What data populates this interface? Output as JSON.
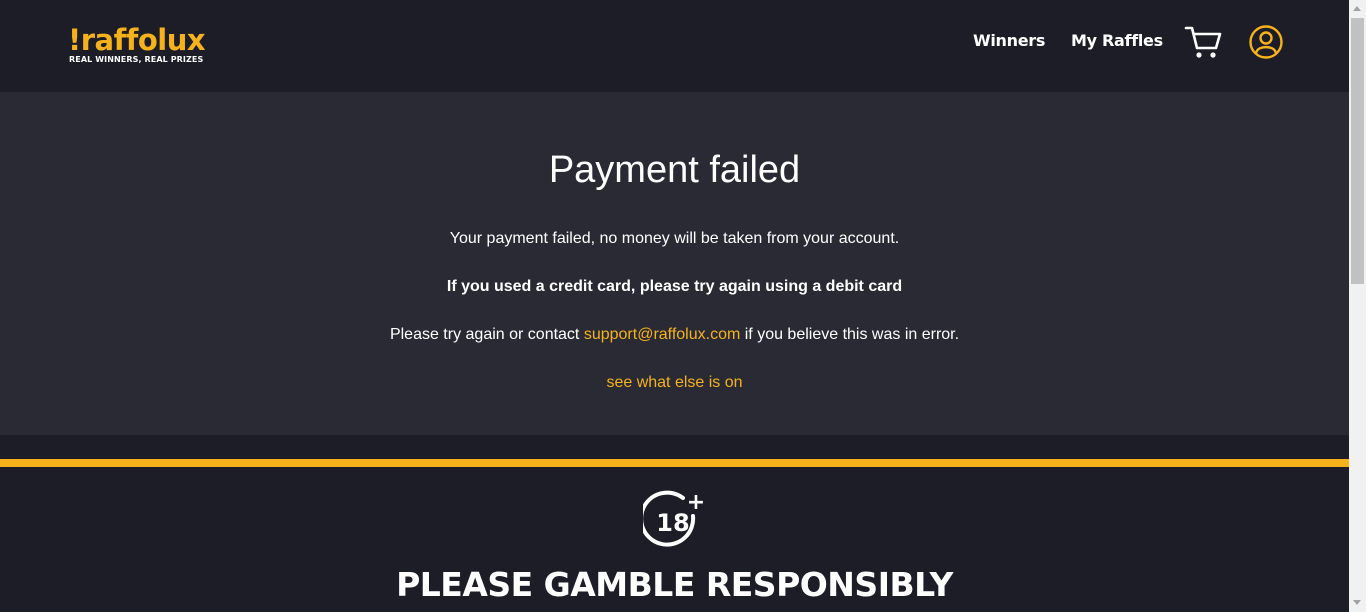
{
  "header": {
    "logo_word": "!raffolux",
    "logo_tagline": "REAL WINNERS, REAL PRIZES",
    "nav": [
      {
        "label": "Winners"
      },
      {
        "label": "My Raffles"
      }
    ],
    "cart_icon": "shopping-cart-icon",
    "user_icon": "user-circle-icon"
  },
  "main": {
    "title": "Payment failed",
    "message": "Your payment failed, no money will be taken from your account.",
    "credit_card_note": "If you used a credit card, please try again using a debit card",
    "contact_prefix": "Please try again or contact ",
    "support_email": "support@raffolux.com",
    "contact_suffix": " if you believe this was in error.",
    "see_more_link": "see what else is on"
  },
  "footer": {
    "age_badge": "18",
    "age_badge_plus": "+",
    "gamble_text": "PLEASE GAMBLE RESPONSIBLY"
  },
  "colors": {
    "accent": "#f6b21a",
    "header_bg": "#1d1d27",
    "panel_bg": "#2a2a35"
  }
}
